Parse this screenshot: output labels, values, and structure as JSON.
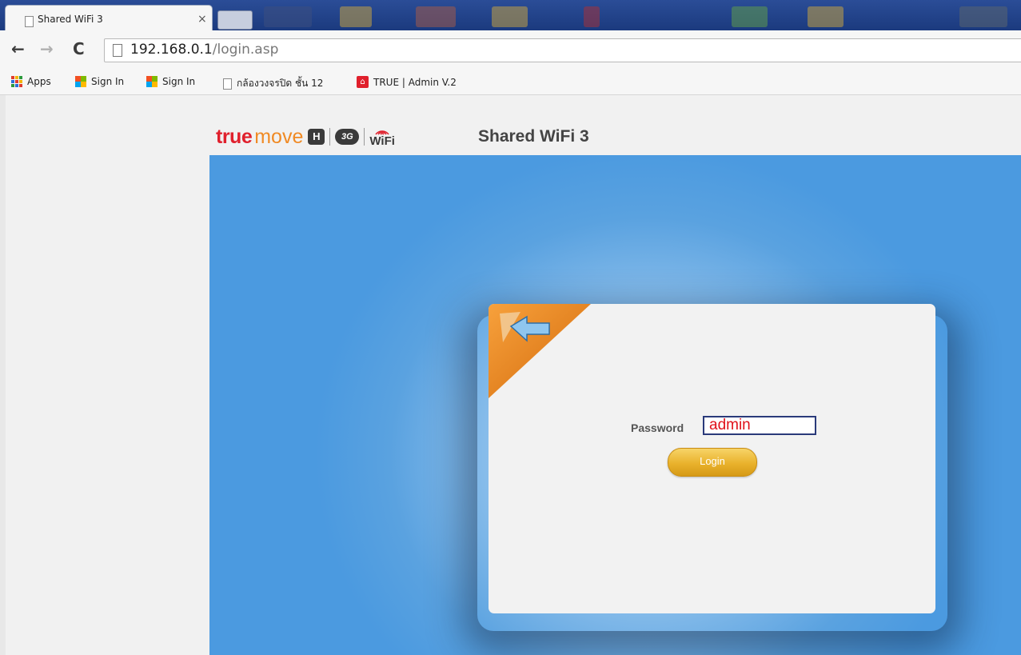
{
  "browser": {
    "tab_title": "Shared WiFi 3",
    "tab_close": "×",
    "url_host": "192.168.0.1",
    "url_path": "/login.asp",
    "bookmarks": [
      {
        "label": "Apps",
        "icon": "apps-grid-icon"
      },
      {
        "label": "Sign In",
        "icon": "windows-logo-icon"
      },
      {
        "label": "Sign In",
        "icon": "windows-logo-icon"
      },
      {
        "label": "กล้องวงจรปิด ชั้น 12",
        "icon": "page-icon"
      },
      {
        "label": "TRUE | Admin V.2",
        "icon": "true-home-icon"
      }
    ]
  },
  "header": {
    "logo_true": "true",
    "logo_move": "move",
    "logo_h": "H",
    "logo_3g": "3G",
    "logo_wifi": "WiFi",
    "title": "Shared WiFi 3"
  },
  "login": {
    "password_label": "Password",
    "password_value": "admin",
    "login_button": "Login"
  },
  "colors": {
    "brand_red": "#e0202c",
    "brand_orange": "#f08a24",
    "stage_blue": "#4b9ae0",
    "button_gold": "#e9b22c",
    "input_text": "#e0101a"
  }
}
